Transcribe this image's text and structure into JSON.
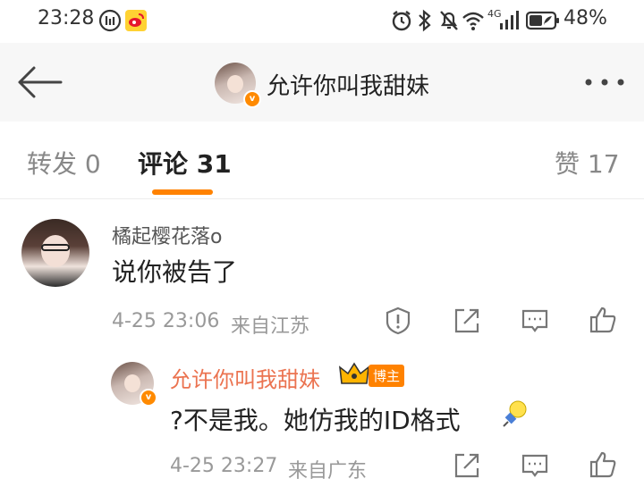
{
  "status_bar": {
    "time": "23:28",
    "battery_percent": "48%",
    "network": "4G",
    "icons": [
      "notification-icon",
      "weibo-app-icon",
      "alarm-icon",
      "bluetooth-icon",
      "mute-icon",
      "wifi-icon",
      "signal-icon",
      "battery-icon"
    ]
  },
  "header": {
    "title": "允许你叫我甜妹",
    "back_icon": "back-arrow-icon",
    "more_icon": "more-options-icon"
  },
  "tabs": {
    "repost": "转发 0",
    "comments": "评论 31",
    "likes": "赞 17"
  },
  "comments": [
    {
      "username": "橘起樱花落o",
      "text": "说你被告了",
      "time": "4-25 23:06",
      "location": "来自江苏",
      "reply": {
        "username": "允许你叫我甜妹",
        "badge": "博主",
        "text": "?不是我。她仿我的ID格式",
        "time": "4-25 23:27",
        "location": "来自广东"
      }
    }
  ],
  "colors": {
    "accent": "#ff8200",
    "name_orange": "#eb7350"
  }
}
